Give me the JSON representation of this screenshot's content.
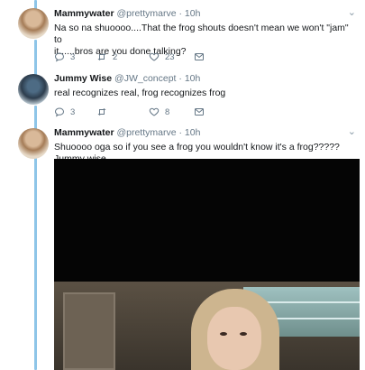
{
  "tweets": [
    {
      "name": "Mammywater",
      "handle": "@prettymarve",
      "time": "10h",
      "text_line1": "Na so na shuoooo....That the frog shouts doesn't mean we won't \"jam\" to",
      "text_line2": "it......bros are you done talking?",
      "replies": "3",
      "retweets": "2",
      "likes": "23"
    },
    {
      "name": "Jummy Wise",
      "handle": "@JW_concept",
      "time": "10h",
      "text_line1": "real recognizes real, frog recognizes frog",
      "replies": "3",
      "retweets": "",
      "likes": "8"
    },
    {
      "name": "Mammywater",
      "handle": "@prettymarve",
      "time": "10h",
      "text_line1": "Shuoooo oga so if you see a frog you wouldn't know it's a frog?????Jummy wise"
    }
  ],
  "separator": "·",
  "chevron_glyph": "⌄",
  "colors": {
    "thread_line": "#8ec5e8",
    "handle_gray": "#657786"
  }
}
